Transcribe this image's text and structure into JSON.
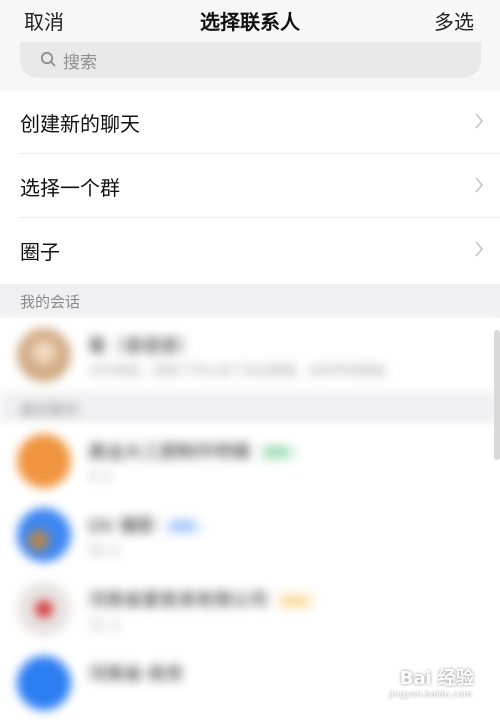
{
  "header": {
    "cancel_label": "取消",
    "title": "选择联系人",
    "multi_label": "多选"
  },
  "search": {
    "placeholder": "搜索"
  },
  "menu": {
    "items": [
      {
        "label": "创建新的聊天"
      },
      {
        "label": "选择一个群"
      },
      {
        "label": "圈子"
      }
    ]
  },
  "sections": {
    "my_chats": "我的会话",
    "recent": "最近聊天"
  },
  "chats": [
    {
      "name": "菊（语语音）",
      "sub": "大约有些，回来了可以没了在在那里，在好早来朋友"
    }
  ],
  "contacts": [
    {
      "name": "奥运大三厨制作特辑",
      "badge": "群聊",
      "sub": "3 人",
      "avatar_color": "#f0953f",
      "badge_color": "#35b66b"
    },
    {
      "name": "OV 摄影",
      "badge": "群聊",
      "sub": "10 人",
      "avatar_color": "#3d86f2",
      "badge_color": "#3d86f2"
    },
    {
      "name": "河南省宴家具有限公司",
      "badge": "企业",
      "sub": "11 人",
      "avatar_color": "#e7e3e1",
      "badge_color": "#e8a200"
    },
    {
      "name": "河南省·商务",
      "badge": "",
      "sub": "",
      "avatar_color": "#2c7ef2",
      "badge_color": "#3d86f2"
    }
  ],
  "watermark": {
    "main": "Bai 经验",
    "sub": "jingyan.baidu.com"
  },
  "colors": {
    "header_bg": "#f7f7f7",
    "section_bg": "#f0f0f2",
    "search_bg": "#e9e9ea"
  }
}
